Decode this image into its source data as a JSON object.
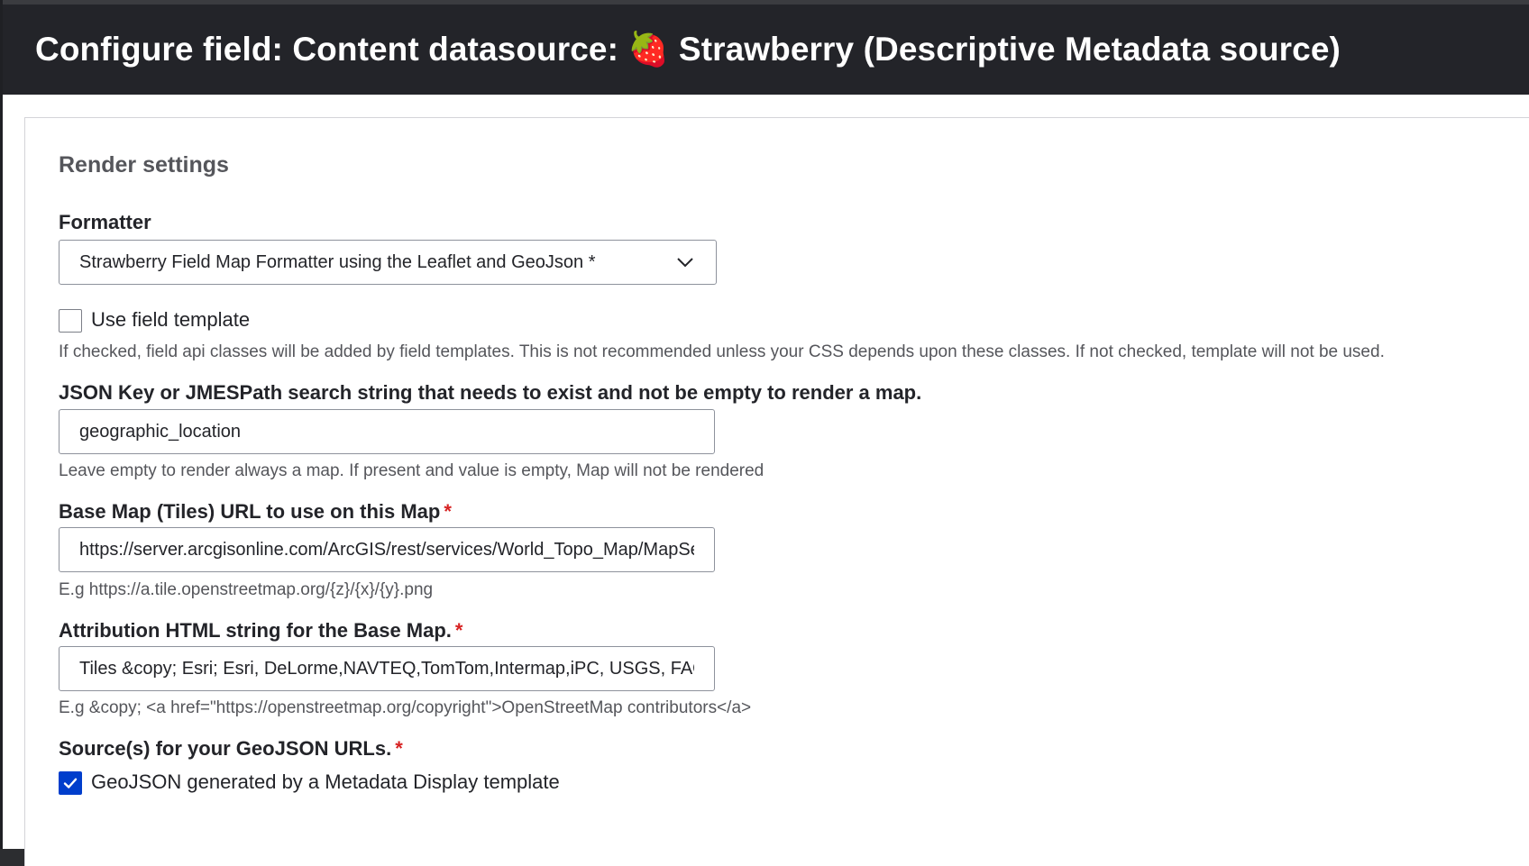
{
  "header": {
    "title": "Configure field: Content datasource: 🍓 Strawberry (Descriptive Metadata source)"
  },
  "form": {
    "section_title": "Render settings",
    "formatter": {
      "label": "Formatter",
      "selected": "Strawberry Field Map Formatter using the Leaflet and GeoJson *"
    },
    "use_field_template": {
      "label": "Use field template",
      "checked": false,
      "description": "If checked, field api classes will be added by field templates. This is not recommended unless your CSS depends upon these classes. If not checked, template will not be used."
    },
    "json_key": {
      "label": "JSON Key or JMESPath search string that needs to exist and not be empty to render a map.",
      "value": "geographic_location",
      "description": "Leave empty to render always a map. If present and value is empty, Map will not be rendered"
    },
    "base_map": {
      "label": "Base Map (Tiles) URL to use on this Map",
      "required_mark": "*",
      "value": "https://server.arcgisonline.com/ArcGIS/rest/services/World_Topo_Map/MapServer/tile/{z}/{y}/{x}",
      "description": "E.g https://a.tile.openstreetmap.org/{z}/{x}/{y}.png"
    },
    "attribution": {
      "label": "Attribution HTML string for the Base Map.",
      "required_mark": "*",
      "value": "Tiles &copy; Esri; Esri, DeLorme,NAVTEQ,TomTom,Intermap,iPC, USGS, FAO, NPS, NRCAN",
      "description": "E.g &copy; <a href=\"https://openstreetmap.org/copyright\">OpenStreetMap contributors</a>"
    },
    "geojson_sources": {
      "label": "Source(s) for your GeoJSON URLs.",
      "required_mark": "*",
      "option_label": "GeoJSON generated by a Metadata Display template",
      "checked": true
    }
  },
  "colors": {
    "header_bg": "#232429",
    "checkbox_checked": "#003ecc",
    "required": "#d72222"
  }
}
